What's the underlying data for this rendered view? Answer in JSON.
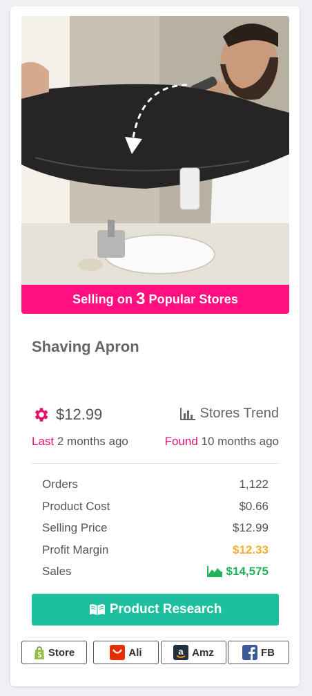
{
  "banner": {
    "prefix": "Selling on",
    "count": "3",
    "suffix": "Popular Stores"
  },
  "product": {
    "title": "Shaving Apron",
    "price": "$12.99"
  },
  "trend": {
    "label": "Stores Trend"
  },
  "meta": {
    "last_label": "Last",
    "last_value": "2 months ago",
    "found_label": "Found",
    "found_value": "10 months ago"
  },
  "stats": [
    {
      "label": "Orders",
      "value": "1,122"
    },
    {
      "label": "Product Cost",
      "value": "$0.66"
    },
    {
      "label": "Selling Price",
      "value": "$12.99"
    },
    {
      "label": "Profit Margin",
      "value": "$12.33"
    },
    {
      "label": "Sales",
      "value": "$14,575"
    }
  ],
  "research_button": {
    "label": "Product Research"
  },
  "store_links": [
    {
      "label": "Store",
      "icon": "shopify-bag-icon"
    },
    {
      "label": "Ali",
      "icon": "aliexpress-icon"
    },
    {
      "label": "Amz",
      "icon": "amazon-icon"
    },
    {
      "label": "FB",
      "icon": "facebook-icon"
    }
  ],
  "colors": {
    "accent_pink": "#ff0f80",
    "teal_button": "#1dbf9f",
    "profit_orange": "#f6ad2f",
    "sales_green": "#22b45a"
  }
}
